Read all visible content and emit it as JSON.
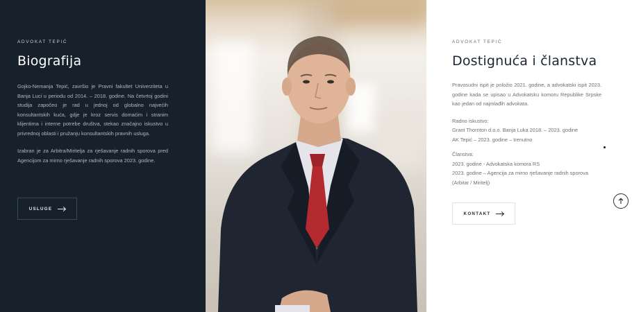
{
  "left": {
    "eyebrow": "ADVOKAT TEPIĆ",
    "title": "Biografija",
    "paragraph1": "Gojko-Nemanja Tepić, završio je Pravni fakultet Univerziteta u Banja Luci u periodu od 2014. – 2018. godine. Na četvrtoj godini studija započeo je rad u jednoj od globalno najvećih konsultantskih kuća, gdje je kroz servis domaćim i stranim klijentima i interne potrebe društva, stekao značajno iskustvo u privrednoj oblasti i pružanju konsultantskih pravnih usluga.",
    "paragraph2": "Izabran je za Arbitra/Miritelja za rješavanje radnih sporova pred Agencijom za mirno rješavanje radnih sporova 2023. godine.",
    "button_label": "USLUGE"
  },
  "right": {
    "eyebrow": "ADVOKAT TEPIĆ",
    "title": "Dostignuća i članstva",
    "paragraph1": "Pravosudni ispit je položio 2021. godine, a advokatski ispit 2023. godine kada se upisao u Advokatsku komoru Republike Srpske kao jedan od najmlađih advokata.",
    "work_label": "Radno iskustvo:",
    "work_item1": "Grant Thornton d.o.o. Banja Luka 2018. – 2023. godine",
    "work_item2": "AK Tepić – 2023. godine – trenutno",
    "membership_label": "Članstva:",
    "membership_item1": "2023. godine - Advokatska komora RS",
    "membership_item2": "2023. godine – Agencija za mirno rješavanje radnih sporova (Arbitar / Miritelj)",
    "button_label": "KONTAKT"
  },
  "icons": {
    "arrow": "arrow-right-icon",
    "scroll_top": "arrow-up-icon"
  },
  "colors": {
    "dark_panel": "#16212b",
    "tie": "#b52a2f",
    "suit": "#1f2632"
  }
}
